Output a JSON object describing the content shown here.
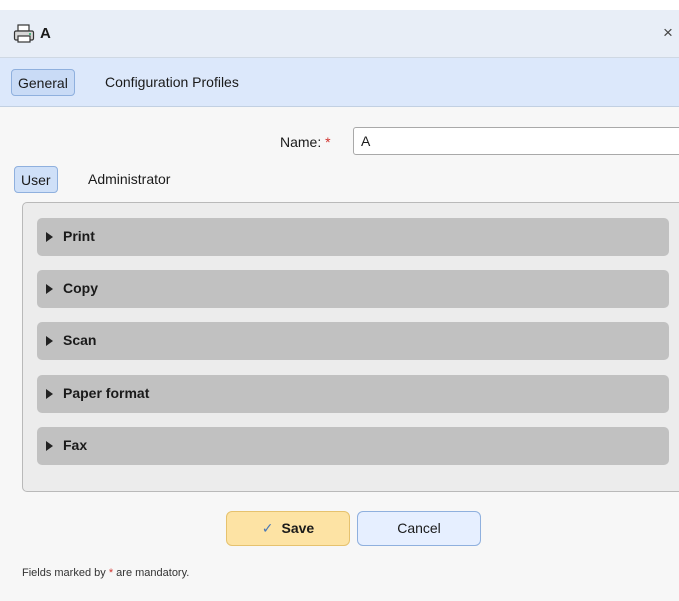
{
  "dialog": {
    "title": "A",
    "icon": "printer-icon",
    "close_glyph": "×"
  },
  "tabs": [
    {
      "label": "General",
      "active": true
    },
    {
      "label": "Configuration Profiles",
      "active": false
    }
  ],
  "form": {
    "name_label": "Name:",
    "required_marker": "*",
    "name_value": "A"
  },
  "subtabs": [
    {
      "label": "User",
      "active": true
    },
    {
      "label": "Administrator",
      "active": false
    }
  ],
  "sections": [
    {
      "label": "Print"
    },
    {
      "label": "Copy"
    },
    {
      "label": "Scan"
    },
    {
      "label": "Paper format"
    },
    {
      "label": "Fax"
    }
  ],
  "buttons": {
    "save_label": "Save",
    "save_icon": "✓",
    "cancel_label": "Cancel"
  },
  "footnote": {
    "before": "Fields marked by",
    "marker": "*",
    "after": "are mandatory."
  },
  "colors": {
    "accent_tab": "#c9dbf6",
    "save_button": "#fde3a4",
    "cancel_button": "#e6efff",
    "required": "#d0322d",
    "section_bar": "#c1c1c1"
  }
}
